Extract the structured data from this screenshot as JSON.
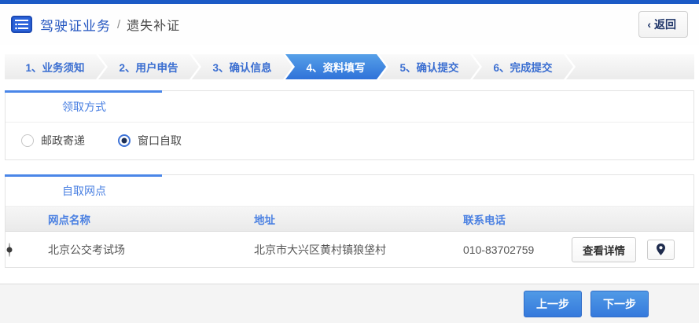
{
  "header": {
    "title_primary": "驾驶证业务",
    "title_separator": "/",
    "title_secondary": "遗失补证",
    "back_chevron": "‹",
    "back_label": "返回"
  },
  "steps": {
    "items": [
      {
        "label": "1、业务须知",
        "active": false
      },
      {
        "label": "2、用户申告",
        "active": false
      },
      {
        "label": "3、确认信息",
        "active": false
      },
      {
        "label": "4、资料填写",
        "active": true
      },
      {
        "label": "5、确认提交",
        "active": false
      },
      {
        "label": "6、完成提交",
        "active": false
      }
    ]
  },
  "pickup_method": {
    "section_title": "领取方式",
    "options": [
      {
        "label": "邮政寄递",
        "selected": false
      },
      {
        "label": "窗口自取",
        "selected": true
      }
    ]
  },
  "pickup_outlets": {
    "section_title": "自取网点",
    "columns": {
      "name": "网点名称",
      "address": "地址",
      "phone": "联系电话"
    },
    "rows": [
      {
        "selected": true,
        "name": "北京公交考试场",
        "address": "北京市大兴区黄村镇狼垡村",
        "phone": "010-83702759",
        "detail_label": "查看详情",
        "map_icon": "location-pin"
      }
    ]
  },
  "footer": {
    "prev_label": "上一步",
    "next_label": "下一步"
  },
  "colors": {
    "top_bar": "#1b5ac6",
    "accent_blue": "#4a86e8",
    "active_step": "#2f72d9",
    "link_blue": "#3a6ed1",
    "button_blue": "#3c83e0"
  }
}
